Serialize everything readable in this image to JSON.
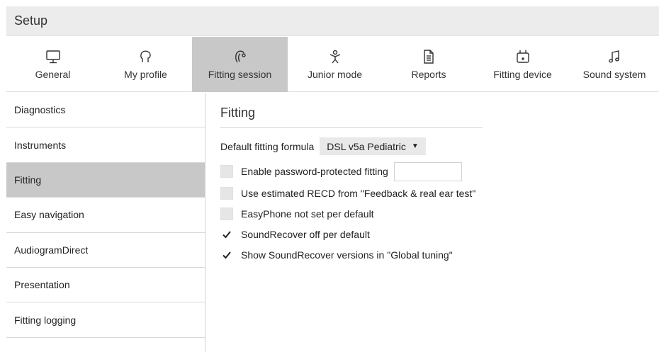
{
  "window": {
    "title": "Setup"
  },
  "tabs": [
    {
      "label": "General",
      "icon": "monitor-icon"
    },
    {
      "label": "My profile",
      "icon": "person-profile-icon"
    },
    {
      "label": "Fitting session",
      "icon": "hearing-aid-icon",
      "active": true
    },
    {
      "label": "Junior mode",
      "icon": "child-icon"
    },
    {
      "label": "Reports",
      "icon": "document-icon"
    },
    {
      "label": "Fitting device",
      "icon": "fitting-device-icon"
    },
    {
      "label": "Sound system",
      "icon": "music-note-icon"
    }
  ],
  "sidebar": {
    "items": [
      {
        "label": "Diagnostics"
      },
      {
        "label": "Instruments"
      },
      {
        "label": "Fitting",
        "active": true
      },
      {
        "label": "Easy navigation"
      },
      {
        "label": "AudiogramDirect"
      },
      {
        "label": "Presentation"
      },
      {
        "label": "Fitting logging"
      }
    ]
  },
  "main": {
    "section_title": "Fitting",
    "formula": {
      "label": "Default fitting formula",
      "value": "DSL v5a Pediatric"
    },
    "options": [
      {
        "label": "Enable password-protected fitting",
        "checked": false,
        "password_value": ""
      },
      {
        "label": "Use estimated RECD from \"Feedback & real ear test\"",
        "checked": false
      },
      {
        "label": "EasyPhone not set per default",
        "checked": false
      },
      {
        "label": "SoundRecover off per default",
        "checked": true
      },
      {
        "label": "Show SoundRecover versions in \"Global tuning\"",
        "checked": true
      }
    ]
  }
}
